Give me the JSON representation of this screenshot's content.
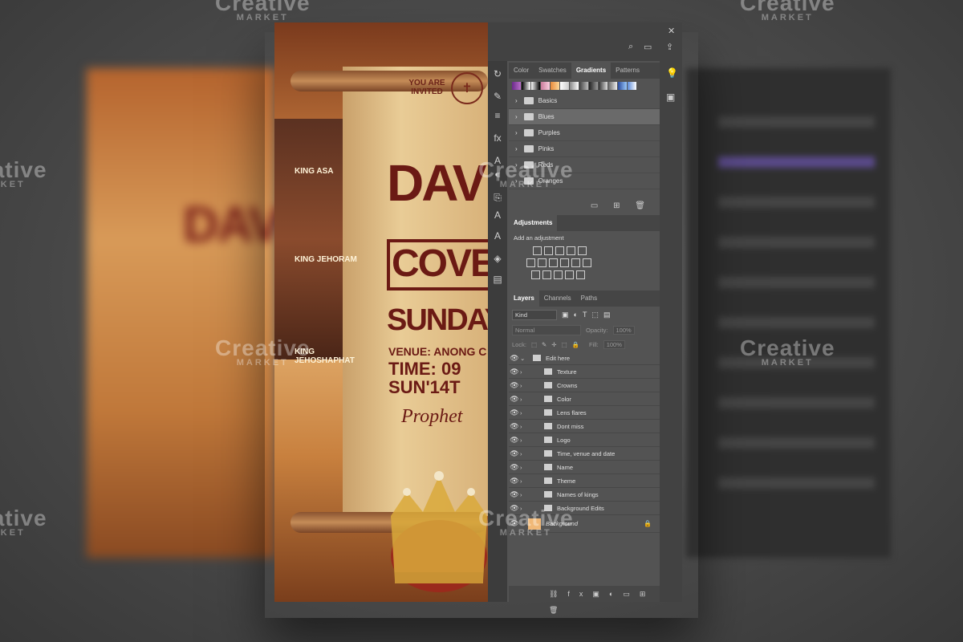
{
  "watermark": {
    "brand": "Creative",
    "sub": "MARKET"
  },
  "poster": {
    "invited": "YOU ARE INVITED",
    "title_line1": "DAV",
    "title_line2": "COVE",
    "title_line3": "SUNDAY",
    "venue": "VENUE: ANONG C",
    "time": "TIME: 09",
    "date": "SUN'14T",
    "prophet": "Prophet",
    "kings": [
      "KING ASA",
      "KING JEHORAM",
      "KING JEHOSHAPHAT"
    ]
  },
  "photoshop": {
    "swatch_tabs": [
      "Color",
      "Swatches",
      "Gradients",
      "Patterns"
    ],
    "active_swatch_tab": "Gradients",
    "gradient_folders": [
      "Basics",
      "Blues",
      "Purples",
      "Pinks",
      "Reds",
      "Oranges"
    ],
    "selected_folder": "Blues",
    "adjustments": {
      "title": "Adjustments",
      "add_label": "Add an adjustment"
    },
    "layer_tabs": [
      "Layers",
      "Channels",
      "Paths"
    ],
    "filter_kind": "Kind",
    "blend_mode": "Normal",
    "opacity_label": "Opacity:",
    "opacity_value": "100%",
    "lock_label": "Lock:",
    "fill_label": "Fill:",
    "fill_value": "100%",
    "layers": [
      "Edit here",
      "Texture",
      "Crowns",
      "Color",
      "Lens flares",
      "Dont miss",
      "Logo",
      "Time, venue and date",
      "Name",
      "Theme",
      "Names of kings",
      "Background Edits",
      "Background"
    ]
  },
  "colors": {
    "accent": "#6b1a14",
    "ps_bg": "#535353",
    "ps_dark": "#3c3c3c"
  }
}
